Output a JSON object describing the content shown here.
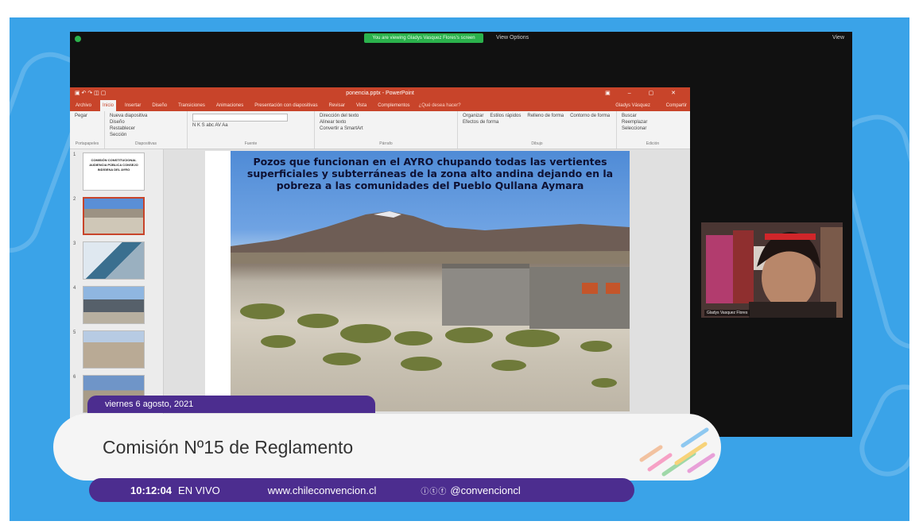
{
  "zoom": {
    "share_banner": "You are viewing Gladys Vasquez Flores's screen",
    "view_options": "View Options",
    "view_label": "View"
  },
  "ppt": {
    "window_title": "ponencia.pptx - PowerPoint",
    "tabs": [
      "Archivo",
      "Inicio",
      "Insertar",
      "Diseño",
      "Transiciones",
      "Animaciones",
      "Presentación con diapositivas",
      "Revisar",
      "Vista",
      "Complementos"
    ],
    "tell_me": "¿Qué desea hacer?",
    "user": "Gladys Vásquez",
    "share": "Compartir",
    "ribbon_groups": [
      {
        "label": "Portapapeles",
        "items": [
          "Pegar"
        ]
      },
      {
        "label": "Diapositivas",
        "items": [
          "Nueva diapositiva",
          "Diseño",
          "Restablecer",
          "Sección"
        ]
      },
      {
        "label": "Fuente",
        "items": [
          "N  K  S  abc  AV  Aa"
        ]
      },
      {
        "label": "Párrafo",
        "items": [
          "Dirección del texto",
          "Alinear texto",
          "Convertir a SmartArt"
        ]
      },
      {
        "label": "Dibujo",
        "items": [
          "Organizar",
          "Estilos rápidos",
          "Relleno de forma",
          "Contorno de forma",
          "Efectos de forma"
        ]
      },
      {
        "label": "Edición",
        "items": [
          "Buscar",
          "Reemplazar",
          "Seleccionar"
        ]
      }
    ],
    "slide_numbers": [
      "1",
      "2",
      "3",
      "4",
      "5",
      "6"
    ],
    "slide1_text": "COMISIÓN CONSTITUCIONAL AUDIENCIA PÚBLICA CONSEJO INDÍGENA DEL AYRO",
    "slide_title": "Pozos que funcionan en el AYRO chupando todas las vertientes superficiales y subterráneas de la zona alto andina dejando en la pobreza a las comunidades del Pueblo Qullana Aymara"
  },
  "camera": {
    "participant": "Gladys Vasquez Flores"
  },
  "broadcast": {
    "date": "viernes 6 agosto, 2021",
    "title": "Comisión Nº15 de Reglamento",
    "time": "10:12:04",
    "live": "EN VIVO",
    "website": "www.chileconvencion.cl",
    "social_icons": "ⓘⓣⓕ",
    "handle": "@convencioncl"
  },
  "colors": {
    "background": "#3aa3e8",
    "purple": "#4c2d8f",
    "ppt_red": "#c8442a"
  }
}
